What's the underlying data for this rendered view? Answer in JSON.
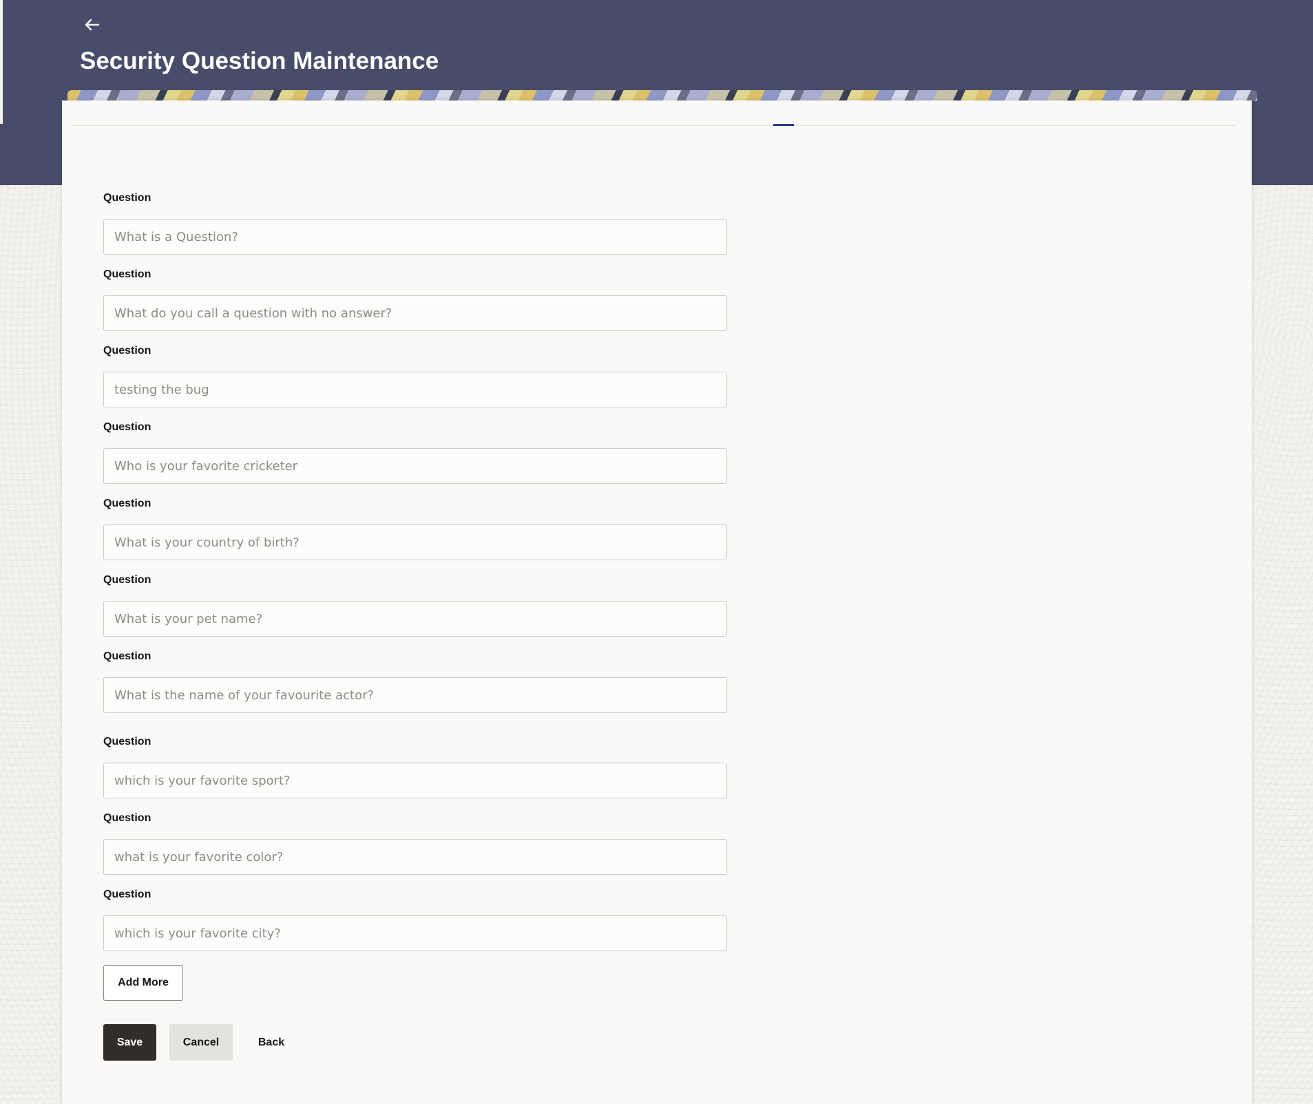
{
  "header": {
    "back_icon": "arrow-left-icon",
    "title": "Security Question Maintenance"
  },
  "colors": {
    "header_background": "#474c69",
    "primary_button": "#312d2a",
    "secondary_button": "#e4e2df",
    "tab_indicator": "#2f3a8a"
  },
  "form": {
    "questions": [
      {
        "label": "Question",
        "placeholder": "What is a Question?"
      },
      {
        "label": "Question",
        "placeholder": "What do you call a question with no answer?"
      },
      {
        "label": "Question",
        "placeholder": "testing the bug"
      },
      {
        "label": "Question",
        "placeholder": "Who is your favorite cricketer"
      },
      {
        "label": "Question",
        "placeholder": "What is your country of birth?"
      },
      {
        "label": "Question",
        "placeholder": "What is your pet name?"
      },
      {
        "label": "Question",
        "placeholder": "What is the name of your favourite actor?"
      },
      {
        "label": "Question",
        "placeholder": "which is your favorite sport?"
      },
      {
        "label": "Question",
        "placeholder": "what is your favorite color?"
      },
      {
        "label": "Question",
        "placeholder": "which is your favorite city?"
      }
    ],
    "add_more_label": "Add More"
  },
  "actions": {
    "save_label": "Save",
    "cancel_label": "Cancel",
    "back_label": "Back"
  }
}
